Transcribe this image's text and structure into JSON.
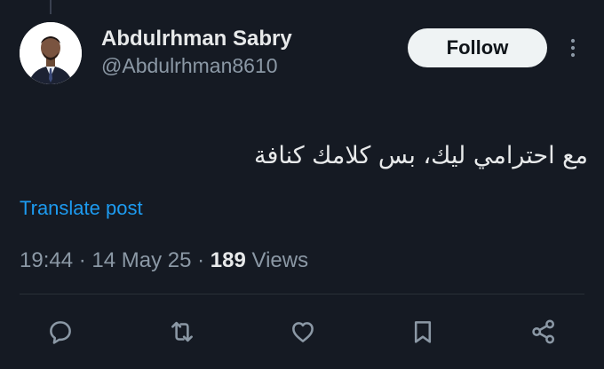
{
  "author": {
    "display_name": "Abdulrhman Sabry",
    "handle": "@Abdulrhman8610"
  },
  "header": {
    "follow_label": "Follow"
  },
  "post": {
    "text": "مع احترامي ليك، بس كلامك كنافة",
    "translate_label": "Translate post"
  },
  "meta": {
    "time": "19:44",
    "separator": " · ",
    "date": "14 May 25",
    "views_count": "189",
    "views_label": " Views"
  },
  "actions": [
    {
      "icon": "reply-icon"
    },
    {
      "icon": "repost-icon"
    },
    {
      "icon": "like-icon"
    },
    {
      "icon": "bookmark-icon"
    },
    {
      "icon": "share-icon"
    }
  ],
  "colors": {
    "background": "#151a23",
    "text_primary": "#e7e9ea",
    "text_secondary": "#8b98a5",
    "link": "#1d9bf0",
    "follow_bg": "#eff3f4"
  }
}
